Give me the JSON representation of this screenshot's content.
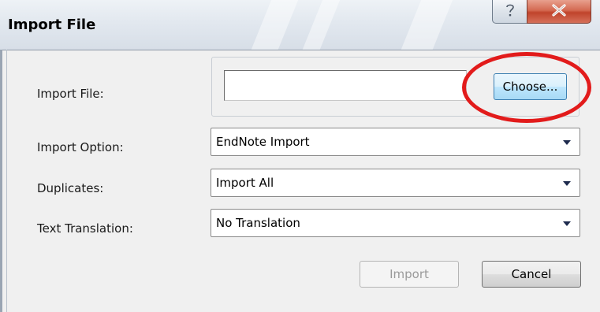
{
  "window": {
    "title": "Import File",
    "help_label": "?",
    "close_label": "X"
  },
  "form": {
    "import_file": {
      "label": "Import File:",
      "value": "",
      "choose_label": "Choose..."
    },
    "import_option": {
      "label": "Import Option:",
      "value": "EndNote Import"
    },
    "duplicates": {
      "label": "Duplicates:",
      "value": "Import All"
    },
    "text_translation": {
      "label": "Text Translation:",
      "value": "No Translation"
    }
  },
  "buttons": {
    "import_label": "Import",
    "cancel_label": "Cancel"
  },
  "colors": {
    "highlight": "#e21b1b",
    "accent": "#3c7fb1"
  },
  "icons": {
    "help": "question-mark-icon",
    "close": "close-icon",
    "dropdown": "chevron-down-icon"
  }
}
